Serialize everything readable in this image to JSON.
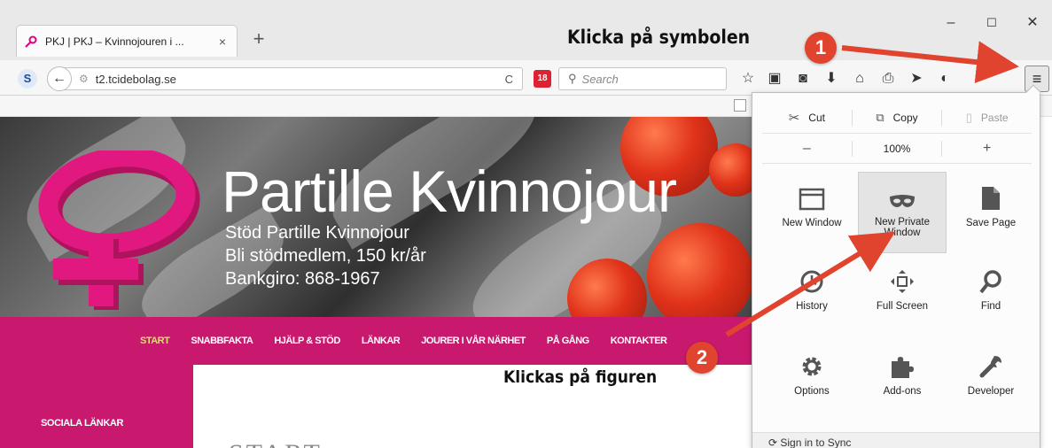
{
  "tab": {
    "title": "PKJ | PKJ – Kvinnojouren i ...",
    "close": "×",
    "new": "+"
  },
  "window": {
    "minimize": "–",
    "maximize": "☐",
    "close": "✕"
  },
  "annotations": {
    "step1_text": "Klicka på symbolen",
    "step2_text": "Klickas på figuren",
    "badge1": "1",
    "badge2": "2"
  },
  "navbar": {
    "url": "t2.tcidebolag.se",
    "search_placeholder": "Search",
    "ext_badge": "18"
  },
  "site": {
    "title": "Partille Kvinnojour",
    "sub1": "Stöd Partille Kvinnojour",
    "sub2": "Bli stödmedlem, 150 kr/år",
    "sub3": "Bankgiro: 868-1967",
    "menu": [
      "START",
      "SNABBFAKTA",
      "HJÄLP & STÖD",
      "LÄNKAR",
      "JOURER I VÅR NÄRHET",
      "PÅ GÅNG",
      "KONTAKTER"
    ],
    "sidebar_heading": "SOCIALA LÄNKAR",
    "page_heading": "START"
  },
  "menu": {
    "cut": "Cut",
    "copy": "Copy",
    "paste": "Paste",
    "zoom_out": "–",
    "zoom": "100%",
    "zoom_in": "+",
    "items": [
      {
        "label": "New Window",
        "icon": "window-icon"
      },
      {
        "label": "New Private Window",
        "icon": "mask-icon"
      },
      {
        "label": "Save Page",
        "icon": "page-icon"
      },
      {
        "label": "History",
        "icon": "clock-icon"
      },
      {
        "label": "Full Screen",
        "icon": "fullscreen-icon"
      },
      {
        "label": "Find",
        "icon": "magnifier-icon"
      },
      {
        "label": "Options",
        "icon": "gear-icon"
      },
      {
        "label": "Add-ons",
        "icon": "puzzle-icon"
      },
      {
        "label": "Developer",
        "icon": "wrench-icon"
      }
    ],
    "footer": "Sign in to Sync"
  },
  "colors": {
    "brand_pink": "#c8196e",
    "annotation_red": "#e0442f",
    "menu_active": "#d9e36a"
  }
}
